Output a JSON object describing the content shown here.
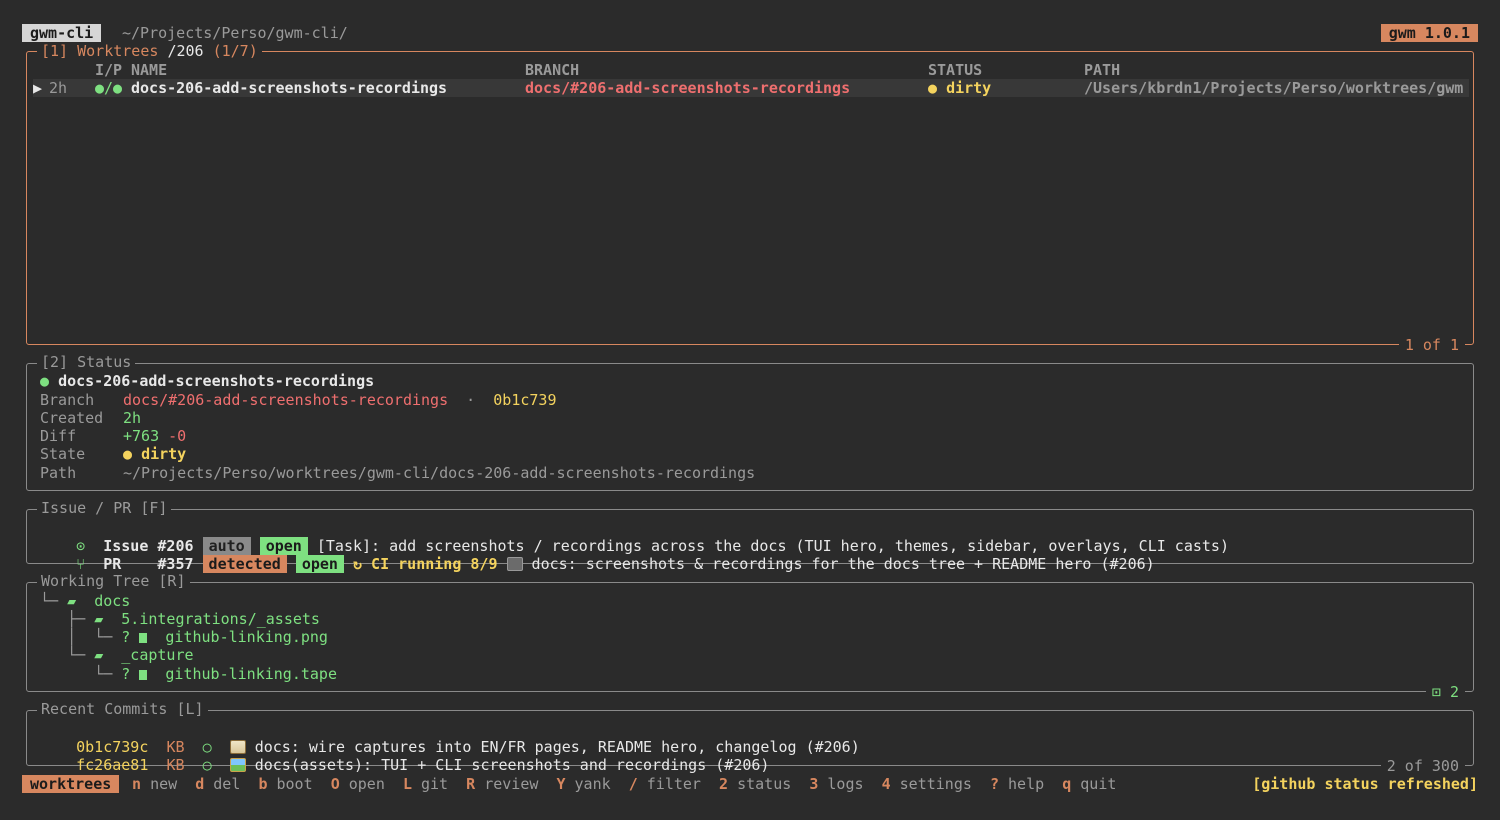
{
  "header": {
    "app_tag": "gwm-cli",
    "cwd": "~/Projects/Perso/gwm-cli/",
    "version_badge": "gwm 1.0.1"
  },
  "worktrees": {
    "title_prefix": "[1] Worktrees ",
    "title_filter": "/206",
    "title_count": " (1/7)",
    "columns": [
      "I/P",
      "NAME",
      "BRANCH",
      "STATUS",
      "PATH"
    ],
    "rows": [
      {
        "marker": "▶",
        "age": "2h",
        "ip": "●/●",
        "name": "docs-206-add-screenshots-recordings",
        "branch": "docs/#206-add-screenshots-recordings",
        "status_dot": "●",
        "status": "dirty",
        "path": "/Users/kbrdn1/Projects/Perso/worktrees/gwm"
      }
    ],
    "footer": "1 of 1"
  },
  "status_panel": {
    "title": "[2] Status",
    "name_dot": "●",
    "name": "docs-206-add-screenshots-recordings",
    "labels": {
      "branch": "Branch",
      "created": "Created",
      "diff": "Diff",
      "state": "State",
      "path": "Path"
    },
    "branch": "docs/#206-add-screenshots-recordings",
    "sep": "·",
    "commit": "0b1c739",
    "created": "2h",
    "diff_add": "+763",
    "diff_del": "-0",
    "state_dot": "●",
    "state": "dirty",
    "path": "~/Projects/Perso/worktrees/gwm-cli/docs-206-add-screenshots-recordings"
  },
  "issue_pr": {
    "title": "Issue / PR [F]",
    "issue": {
      "icon": "⊙",
      "kind": "Issue",
      "number": "#206",
      "badge1": "auto",
      "badge2": "open",
      "text": "[Task]: add screenshots / recordings across the docs (TUI hero, themes, sidebar, overlays, CLI casts)"
    },
    "pr": {
      "icon": "⑂",
      "kind": "PR",
      "number": "#357",
      "badge1": "detected",
      "badge2": "open",
      "ci_icon": "↻",
      "ci": "CI running 8/9",
      "text": "docs: screenshots & recordings for the docs tree + README hero (#206)"
    }
  },
  "working_tree": {
    "title": "Working Tree [R]",
    "nodes": [
      {
        "prefix": "└─ ",
        "kind": "folder",
        "status": "",
        "name": "docs"
      },
      {
        "prefix": "   ├─ ",
        "kind": "folder",
        "status": "",
        "name": "5.integrations/_assets"
      },
      {
        "prefix": "   │  └─ ",
        "kind": "file",
        "status": "?",
        "name": "github-linking.png"
      },
      {
        "prefix": "   └─ ",
        "kind": "folder",
        "status": "",
        "name": "_capture"
      },
      {
        "prefix": "      └─ ",
        "kind": "file",
        "status": "?",
        "name": "github-linking.tape"
      }
    ],
    "footer_icon": "⊡",
    "footer": "2"
  },
  "commits": {
    "title": "Recent Commits [L]",
    "rows": [
      {
        "hash": "0b1c739c",
        "author": "KB",
        "dot": "○",
        "emoji": "memo",
        "message": "docs: wire captures into EN/FR pages, README hero, changelog (#206)"
      },
      {
        "hash": "fc26ae81",
        "author": "KB",
        "dot": "○",
        "emoji": "pic",
        "message": "docs(assets): TUI + CLI screenshots and recordings (#206)"
      }
    ],
    "footer": "2 of 300"
  },
  "statusbar": {
    "mode": "worktrees",
    "keys": [
      {
        "key": "n",
        "label": "new"
      },
      {
        "key": "d",
        "label": "del"
      },
      {
        "key": "b",
        "label": "boot"
      },
      {
        "key": "O",
        "label": "open"
      },
      {
        "key": "L",
        "label": "git"
      },
      {
        "key": "R",
        "label": "review"
      },
      {
        "key": "Y",
        "label": "yank"
      },
      {
        "key": "/",
        "label": "filter"
      },
      {
        "key": "2",
        "label": "status"
      },
      {
        "key": "3",
        "label": "logs"
      },
      {
        "key": "4",
        "label": "settings"
      },
      {
        "key": "?",
        "label": "help"
      },
      {
        "key": "q",
        "label": "quit"
      }
    ],
    "message": "[github status refreshed]"
  },
  "colors": {
    "accent": "#d7875f",
    "branch": "#ef6f6f",
    "ok": "#7ee081",
    "warn": "#f4d35e",
    "bg": "#2b2b2b"
  }
}
